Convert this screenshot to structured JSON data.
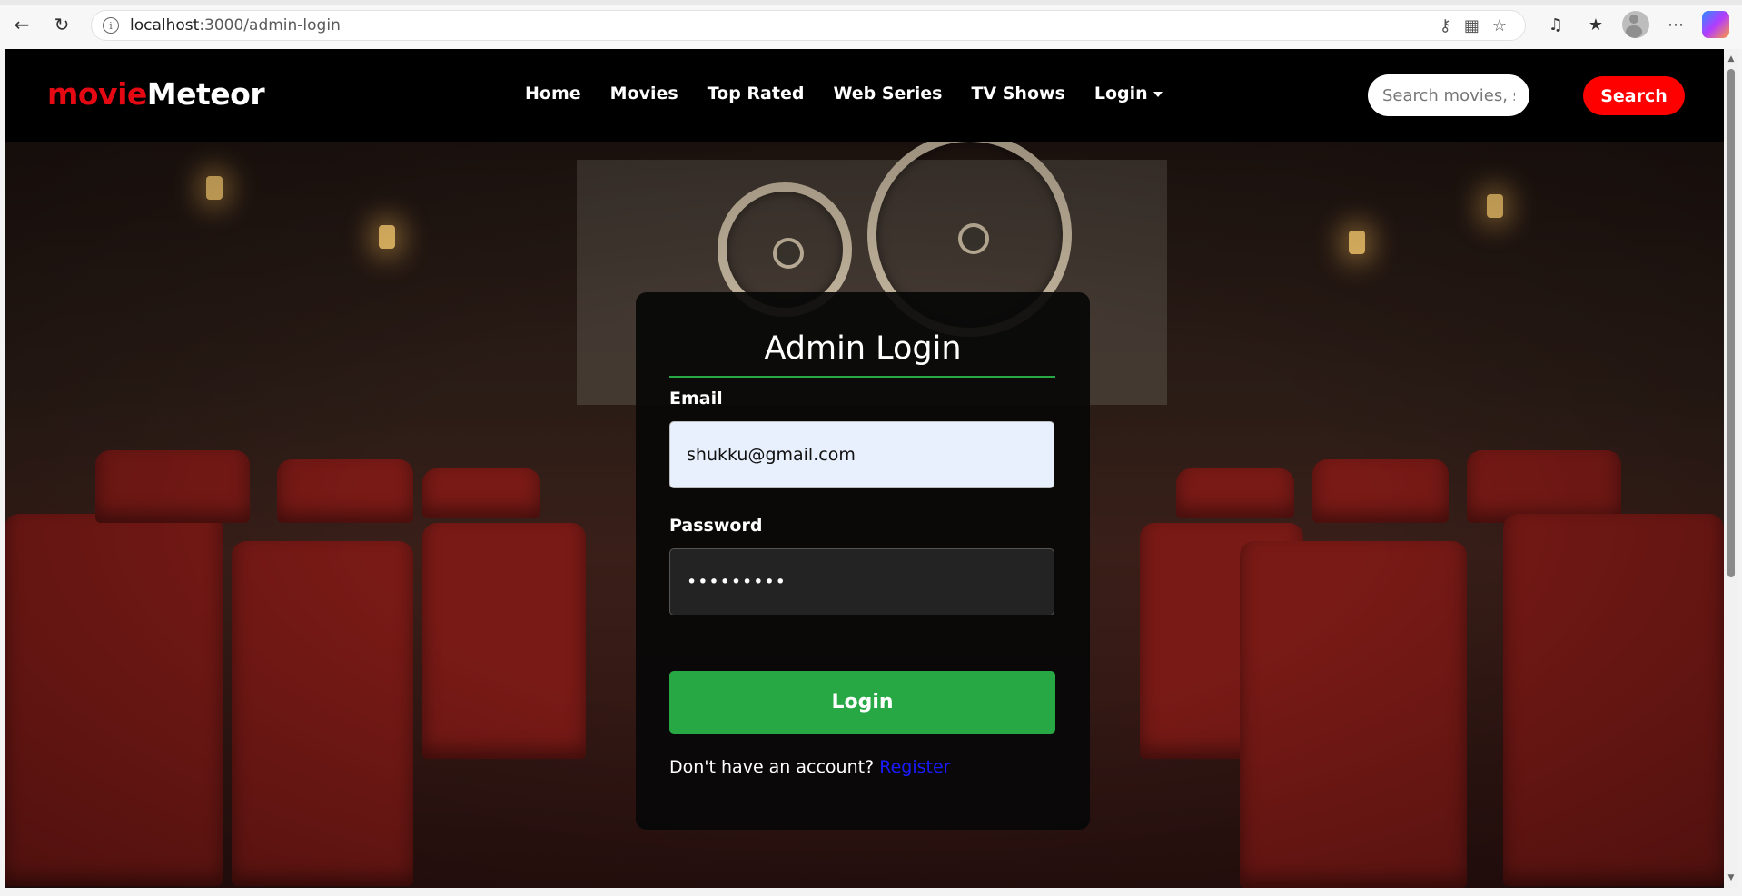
{
  "browser": {
    "url_host": "localhost",
    "url_path": ":3000/admin-login"
  },
  "navbar": {
    "brand_part1": "movie",
    "brand_part2": "Meteor",
    "links": [
      "Home",
      "Movies",
      "Top Rated",
      "Web Series",
      "TV Shows"
    ],
    "login_label": "Login",
    "search_placeholder": "Search movies, series...",
    "search_button": "Search"
  },
  "login_card": {
    "title": "Admin Login",
    "email_label": "Email",
    "email_value": "shukku@gmail.com",
    "password_label": "Password",
    "password_value": "•••••••••",
    "submit_label": "Login",
    "register_prompt": "Don't have an account?",
    "register_link": "Register"
  },
  "colors": {
    "brand_red": "#e50914",
    "search_red": "#ff0000",
    "success_green": "#28a745",
    "link_blue": "#1a1aff"
  }
}
